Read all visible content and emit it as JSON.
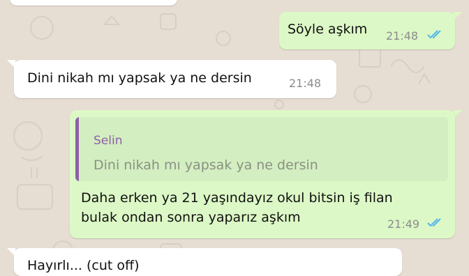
{
  "chat": {
    "messages": [
      {
        "direction": "outgoing",
        "text": "Söyle aşkım",
        "time": "21:48",
        "status": "read"
      },
      {
        "direction": "incoming",
        "text": "Dini nikah mı yapsak ya ne dersin",
        "time": "21:48"
      },
      {
        "direction": "outgoing",
        "reply_to": {
          "author": "Selin",
          "text": "Dini nikah mı yapsak ya ne dersin"
        },
        "lines": [
          "Daha erken ya 21 yaşındayız okul bitsin iş filan",
          "bulak ondan sonra yaparız aşkım"
        ],
        "time": "21:49",
        "status": "read"
      },
      {
        "direction": "incoming",
        "partial_text": "Hayırlı... (cut off)",
        "time": ""
      }
    ]
  },
  "colors": {
    "wallpaper": "#e6ddd3",
    "incoming_bubble": "#ffffff",
    "outgoing_bubble": "#dcf8c6",
    "quote_background": "#d3eec0",
    "quote_author": "#8e5fa8",
    "read_ticks": "#4fb6ec",
    "timestamp": "#8c8c8c"
  },
  "icons": {
    "read_receipt": "double-check-icon"
  }
}
